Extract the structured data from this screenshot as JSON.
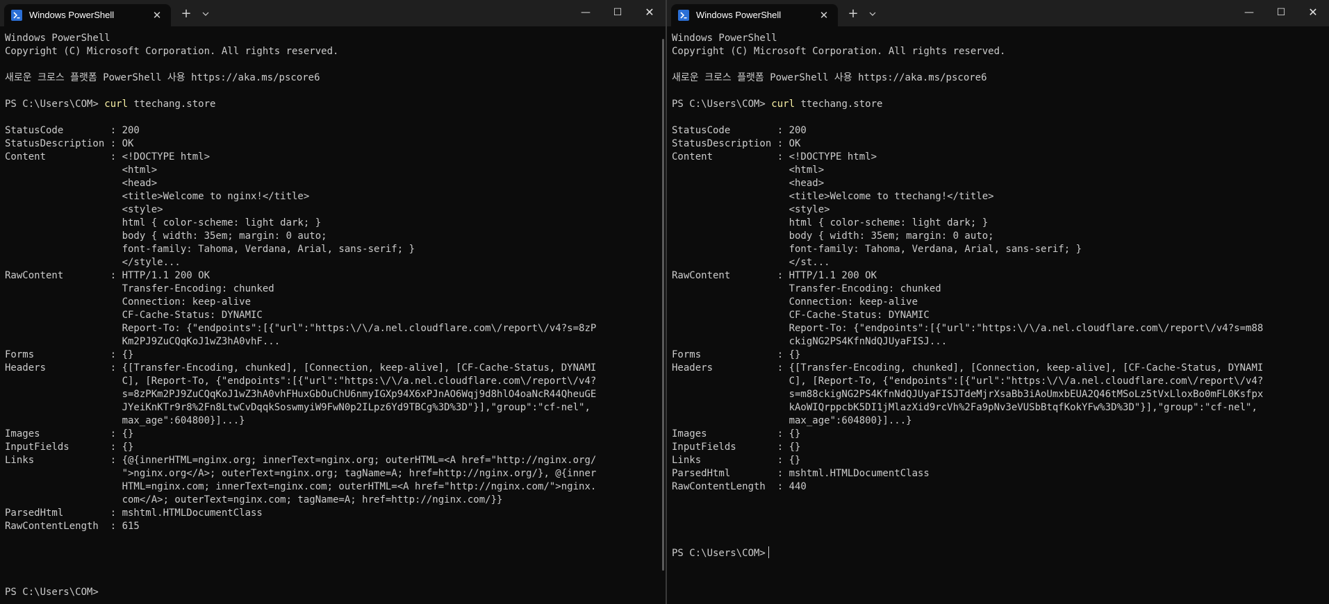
{
  "windows": [
    {
      "tab_title": "Windows PowerShell",
      "tab_close": "✕",
      "new_tab": "+",
      "dropdown": "⌄",
      "min": "—",
      "max": "☐",
      "close": "✕",
      "lines": [
        {
          "text": "Windows PowerShell"
        },
        {
          "text": "Copyright (C) Microsoft Corporation. All rights reserved."
        },
        {
          "text": ""
        },
        {
          "text": "새로운 크로스 플랫폼 PowerShell 사용 https://aka.ms/pscore6"
        },
        {
          "text": ""
        },
        {
          "text": "PS C:\\Users\\COM> ",
          "cmd": "curl",
          "rest": " ttechang.store"
        },
        {
          "text": ""
        },
        {
          "text": "StatusCode        : 200"
        },
        {
          "text": "StatusDescription : OK"
        },
        {
          "text": "Content           : <!DOCTYPE html>"
        },
        {
          "text": "                    <html>"
        },
        {
          "text": "                    <head>"
        },
        {
          "text": "                    <title>Welcome to nginx!</title>"
        },
        {
          "text": "                    <style>"
        },
        {
          "text": "                    html { color-scheme: light dark; }"
        },
        {
          "text": "                    body { width: 35em; margin: 0 auto;"
        },
        {
          "text": "                    font-family: Tahoma, Verdana, Arial, sans-serif; }"
        },
        {
          "text": "                    </style..."
        },
        {
          "text": "RawContent        : HTTP/1.1 200 OK"
        },
        {
          "text": "                    Transfer-Encoding: chunked"
        },
        {
          "text": "                    Connection: keep-alive"
        },
        {
          "text": "                    CF-Cache-Status: DYNAMIC"
        },
        {
          "text": "                    Report-To: {\"endpoints\":[{\"url\":\"https:\\/\\/a.nel.cloudflare.com\\/report\\/v4?s=8zP"
        },
        {
          "text": "                    Km2PJ9ZuCQqKoJ1wZ3hA0vhF..."
        },
        {
          "text": "Forms             : {}"
        },
        {
          "text": "Headers           : {[Transfer-Encoding, chunked], [Connection, keep-alive], [CF-Cache-Status, DYNAMI"
        },
        {
          "text": "                    C], [Report-To, {\"endpoints\":[{\"url\":\"https:\\/\\/a.nel.cloudflare.com\\/report\\/v4?"
        },
        {
          "text": "                    s=8zPKm2PJ9ZuCQqKoJ1wZ3hA0vhFHuxGbOuChU6nmyIGXp94X6xPJnAO6Wqj9d8hlO4oaNcR44QheuGE"
        },
        {
          "text": "                    JYeiKnKTr9r8%2Fn8LtwCvDqqkSoswmyiW9FwN0p2ILpz6Yd9TBCg%3D%3D\"}],\"group\":\"cf-nel\","
        },
        {
          "text": "                    max_age\":604800}]...}"
        },
        {
          "text": "Images            : {}"
        },
        {
          "text": "InputFields       : {}"
        },
        {
          "text": "Links             : {@{innerHTML=nginx.org; innerText=nginx.org; outerHTML=<A href=\"http://nginx.org/"
        },
        {
          "text": "                    \">nginx.org</A>; outerText=nginx.org; tagName=A; href=http://nginx.org/}, @{inner"
        },
        {
          "text": "                    HTML=nginx.com; innerText=nginx.com; outerHTML=<A href=\"http://nginx.com/\">nginx."
        },
        {
          "text": "                    com</A>; outerText=nginx.com; tagName=A; href=http://nginx.com/}}"
        },
        {
          "text": "ParsedHtml        : mshtml.HTMLDocumentClass"
        },
        {
          "text": "RawContentLength  : 615"
        }
      ],
      "prompt": "PS C:\\Users\\COM>"
    },
    {
      "tab_title": "Windows PowerShell",
      "tab_close": "✕",
      "new_tab": "+",
      "dropdown": "⌄",
      "min": "—",
      "max": "☐",
      "close": "✕",
      "lines": [
        {
          "text": "Windows PowerShell"
        },
        {
          "text": "Copyright (C) Microsoft Corporation. All rights reserved."
        },
        {
          "text": ""
        },
        {
          "text": "새로운 크로스 플랫폼 PowerShell 사용 https://aka.ms/pscore6"
        },
        {
          "text": ""
        },
        {
          "text": "PS C:\\Users\\COM> ",
          "cmd": "curl",
          "rest": " ttechang.store"
        },
        {
          "text": ""
        },
        {
          "text": "StatusCode        : 200"
        },
        {
          "text": "StatusDescription : OK"
        },
        {
          "text": "Content           : <!DOCTYPE html>"
        },
        {
          "text": "                    <html>"
        },
        {
          "text": "                    <head>"
        },
        {
          "text": "                    <title>Welcome to ttechang!</title>"
        },
        {
          "text": "                    <style>"
        },
        {
          "text": "                    html { color-scheme: light dark; }"
        },
        {
          "text": "                    body { width: 35em; margin: 0 auto;"
        },
        {
          "text": "                    font-family: Tahoma, Verdana, Arial, sans-serif; }"
        },
        {
          "text": "                    </st..."
        },
        {
          "text": "RawContent        : HTTP/1.1 200 OK"
        },
        {
          "text": "                    Transfer-Encoding: chunked"
        },
        {
          "text": "                    Connection: keep-alive"
        },
        {
          "text": "                    CF-Cache-Status: DYNAMIC"
        },
        {
          "text": "                    Report-To: {\"endpoints\":[{\"url\":\"https:\\/\\/a.nel.cloudflare.com\\/report\\/v4?s=m88"
        },
        {
          "text": "                    ckigNG2PS4KfnNdQJUyaFISJ..."
        },
        {
          "text": "Forms             : {}"
        },
        {
          "text": "Headers           : {[Transfer-Encoding, chunked], [Connection, keep-alive], [CF-Cache-Status, DYNAMI"
        },
        {
          "text": "                    C], [Report-To, {\"endpoints\":[{\"url\":\"https:\\/\\/a.nel.cloudflare.com\\/report\\/v4?"
        },
        {
          "text": "                    s=m88ckigNG2PS4KfnNdQJUyaFISJTdeMjrXsaBb3iAoUmxbEUA2Q46tMSoLz5tVxLloxBo0mFL0Ksfpx"
        },
        {
          "text": "                    kAoWIQrppcbK5DI1jMlazXid9rcVh%2Fa9pNv3eVUSbBtqfKokYFw%3D%3D\"}],\"group\":\"cf-nel\","
        },
        {
          "text": "                    max_age\":604800}]...}"
        },
        {
          "text": "Images            : {}"
        },
        {
          "text": "InputFields       : {}"
        },
        {
          "text": "Links             : {}"
        },
        {
          "text": "ParsedHtml        : mshtml.HTMLDocumentClass"
        },
        {
          "text": "RawContentLength  : 440"
        }
      ],
      "prompt": "PS C:\\Users\\COM>"
    }
  ]
}
